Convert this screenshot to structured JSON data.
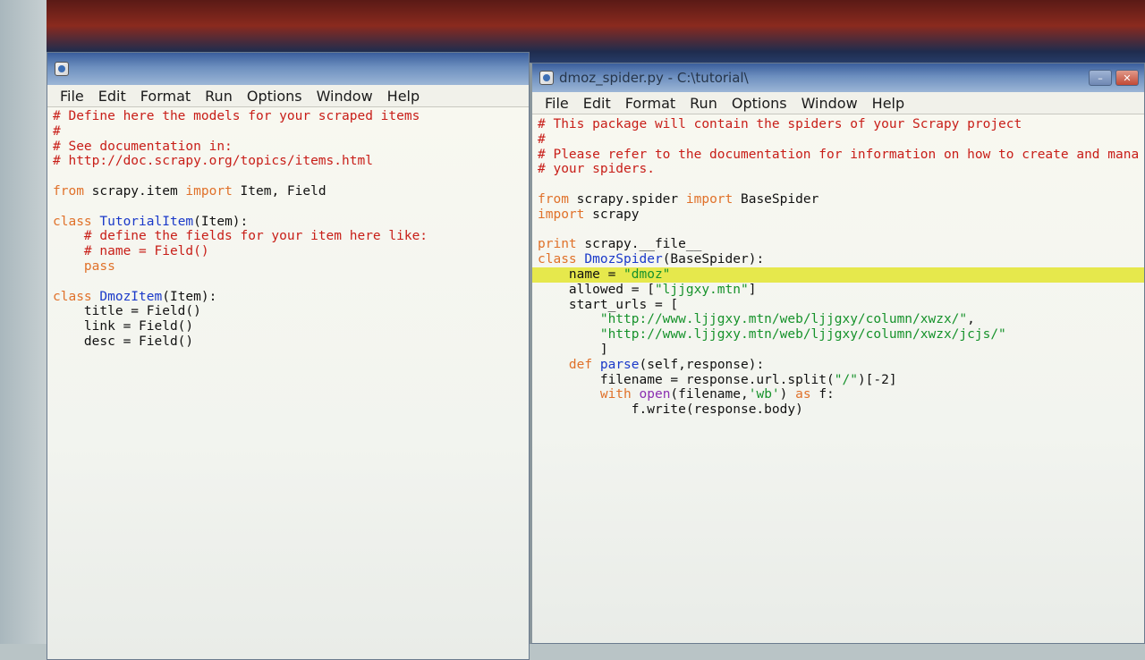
{
  "left_window": {
    "title": "",
    "menu": [
      "File",
      "Edit",
      "Format",
      "Run",
      "Options",
      "Window",
      "Help"
    ],
    "lines": [
      [
        [
          "comment",
          "# Define here the models for your scraped items"
        ]
      ],
      [
        [
          "comment",
          "#"
        ]
      ],
      [
        [
          "comment",
          "# See documentation in:"
        ]
      ],
      [
        [
          "comment",
          "# http://doc.scrapy.org/topics/items.html"
        ]
      ],
      [],
      [
        [
          "kw",
          "from"
        ],
        [
          "plain",
          " scrapy.item "
        ],
        [
          "kw",
          "import"
        ],
        [
          "plain",
          " Item, Field"
        ]
      ],
      [],
      [
        [
          "kw",
          "class"
        ],
        [
          "plain",
          " "
        ],
        [
          "defname",
          "TutorialItem"
        ],
        [
          "plain",
          "(Item):"
        ]
      ],
      [
        [
          "plain",
          "    "
        ],
        [
          "comment",
          "# define the fields for your item here like:"
        ]
      ],
      [
        [
          "plain",
          "    "
        ],
        [
          "comment",
          "# name = Field()"
        ]
      ],
      [
        [
          "plain",
          "    "
        ],
        [
          "kw",
          "pass"
        ]
      ],
      [],
      [
        [
          "kw",
          "class"
        ],
        [
          "plain",
          " "
        ],
        [
          "defname",
          "DmozItem"
        ],
        [
          "plain",
          "(Item):"
        ]
      ],
      [
        [
          "plain",
          "    title = Field()"
        ]
      ],
      [
        [
          "plain",
          "    link = Field()"
        ]
      ],
      [
        [
          "plain",
          "    desc = Field()"
        ]
      ]
    ]
  },
  "right_window": {
    "title": "dmoz_spider.py - C:\\tutorial\\",
    "menu": [
      "File",
      "Edit",
      "Format",
      "Run",
      "Options",
      "Window",
      "Help"
    ],
    "highlight_line": 10,
    "lines": [
      [
        [
          "comment",
          "# This package will contain the spiders of your Scrapy project"
        ]
      ],
      [
        [
          "comment",
          "#"
        ]
      ],
      [
        [
          "comment",
          "# Please refer to the documentation for information on how to create and mana"
        ]
      ],
      [
        [
          "comment",
          "# your spiders."
        ]
      ],
      [],
      [
        [
          "kw",
          "from"
        ],
        [
          "plain",
          " scrapy.spider "
        ],
        [
          "kw",
          "import"
        ],
        [
          "plain",
          " BaseSpider"
        ]
      ],
      [
        [
          "kw",
          "import"
        ],
        [
          "plain",
          " scrapy"
        ]
      ],
      [],
      [
        [
          "kw",
          "print"
        ],
        [
          "plain",
          " scrapy.__file__"
        ]
      ],
      [
        [
          "kw",
          "class"
        ],
        [
          "plain",
          " "
        ],
        [
          "defname",
          "DmozSpider"
        ],
        [
          "plain",
          "(BaseSpider):"
        ]
      ],
      [
        [
          "plain",
          "    name = "
        ],
        [
          "str",
          "\"dmoz\""
        ]
      ],
      [
        [
          "plain",
          "    allowed = ["
        ],
        [
          "str",
          "\"ljjgxy.mtn\""
        ],
        [
          "plain",
          "]"
        ]
      ],
      [
        [
          "plain",
          "    start_urls = ["
        ]
      ],
      [
        [
          "plain",
          "        "
        ],
        [
          "str",
          "\"http://www.ljjgxy.mtn/web/ljjgxy/column/xwzx/\""
        ],
        [
          "plain",
          ","
        ]
      ],
      [
        [
          "plain",
          "        "
        ],
        [
          "str",
          "\"http://www.ljjgxy.mtn/web/ljjgxy/column/xwzx/jcjs/\""
        ]
      ],
      [
        [
          "plain",
          "        ]"
        ]
      ],
      [
        [
          "plain",
          "    "
        ],
        [
          "kw",
          "def"
        ],
        [
          "plain",
          " "
        ],
        [
          "defname",
          "parse"
        ],
        [
          "plain",
          "(self,response):"
        ]
      ],
      [
        [
          "plain",
          "        filename = response.url.split("
        ],
        [
          "str",
          "\"/\""
        ],
        [
          "plain",
          ")[-2]"
        ]
      ],
      [
        [
          "plain",
          "        "
        ],
        [
          "kw",
          "with"
        ],
        [
          "plain",
          " "
        ],
        [
          "builtin",
          "open"
        ],
        [
          "plain",
          "(filename,"
        ],
        [
          "str",
          "'wb'"
        ],
        [
          "plain",
          ") "
        ],
        [
          "kw",
          "as"
        ],
        [
          "plain",
          " f:"
        ]
      ],
      [
        [
          "plain",
          "            f.write(response.body)"
        ]
      ]
    ]
  }
}
